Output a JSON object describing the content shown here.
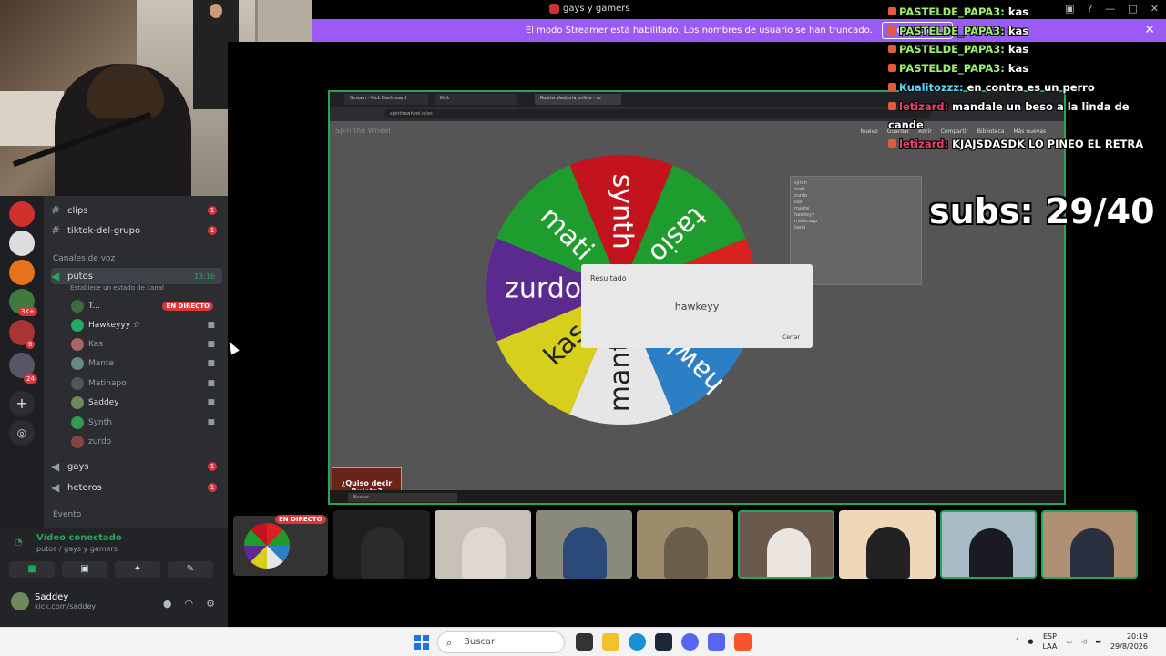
{
  "window": {
    "title": "gays y gamers"
  },
  "banner": {
    "text": "El modo Streamer está habilitado. Los nombres de usuario se han truncado.",
    "button": "Deshabilitar"
  },
  "channels": {
    "text": [
      {
        "name": "clips",
        "badge": "1"
      },
      {
        "name": "tiktok-del-grupo",
        "badge": "1"
      }
    ],
    "voice_category": "Canales de voz",
    "active_voice": {
      "name": "putos",
      "time": "13:16",
      "status": "Establece un estado de canal"
    },
    "members": [
      {
        "name": "T...",
        "live": "EN DIRECTO",
        "dim": false
      },
      {
        "name": "Hawkeyyy ☆",
        "dim": false
      },
      {
        "name": "Kas",
        "dim": true
      },
      {
        "name": "Mante",
        "dim": true
      },
      {
        "name": "Matinapo",
        "dim": true
      },
      {
        "name": "Saddey",
        "dim": false
      },
      {
        "name": "Synth",
        "dim": true
      },
      {
        "name": "zurdo",
        "dim": true
      }
    ],
    "other_voice": [
      {
        "name": "gays",
        "badge": "1"
      },
      {
        "name": "heteros",
        "badge": "1"
      }
    ],
    "events_category": "Evento"
  },
  "servers": {
    "badges": [
      "3K+",
      "6",
      "24"
    ]
  },
  "voice_panel": {
    "status": "Vídeo conectado",
    "location": "putos / gays y gamers",
    "user": "Saddey",
    "user_status": "kick.com/saddey"
  },
  "stream": {
    "url": "spinthewheel.io/es",
    "tabs": [
      "Stream - Kick Dashboard",
      "Kick",
      "Ruleta aleatoria online - ru"
    ],
    "logo": "Spin the Wheel",
    "toolbar": [
      "Nuevo",
      "Guardar",
      "Abrir",
      "Compartir",
      "Biblioteca",
      "Más nuevas"
    ],
    "entries": [
      "synth",
      "mati",
      "zurdo",
      "kas",
      "mante",
      "hawkeyy",
      "matecapp",
      "tasio"
    ],
    "wheel_segments": [
      {
        "label": "tasio",
        "color": "#1e9c2e"
      },
      {
        "label": "matecapp",
        "color": "#d9221f"
      },
      {
        "label": "hawkeyy",
        "color": "#2d7fc5"
      },
      {
        "label": "mante",
        "color": "#e6e6e6"
      },
      {
        "label": "kas",
        "color": "#d6cf1c"
      },
      {
        "label": "zurdo",
        "color": "#5b2a8e"
      },
      {
        "label": "mati",
        "color": "#1e9c2e"
      },
      {
        "label": "synth",
        "color": "#c3141d"
      }
    ],
    "result": {
      "label": "Resultado",
      "value": "hawkeyy",
      "close": "Cerrar"
    },
    "badge": "¿Quiso decir Ruleta?",
    "taskbar_search": "Buscar"
  },
  "chat": [
    {
      "name": "PASTELDE_PAPA3",
      "text": "kas",
      "color": "n1"
    },
    {
      "name": "PASTELDE_PAPA3",
      "text": "kas",
      "color": "n1"
    },
    {
      "name": "PASTELDE_PAPA3",
      "text": "kas",
      "color": "n1"
    },
    {
      "name": "PASTELDE_PAPA3",
      "text": "kas",
      "color": "n1"
    },
    {
      "name": "Kualitozzz",
      "text": "en contra es un perro",
      "color": "n2"
    },
    {
      "name": "letizard",
      "text": "mandale un beso a la linda de cande",
      "color": "n3"
    },
    {
      "name": "letizard",
      "text": "KJAJSDASDK LO PINEO EL RETRA",
      "color": "n3"
    }
  ],
  "subs": "subs: 29/40",
  "live_tag": "EN DIRECTO",
  "taskbar": {
    "search": "Buscar",
    "lang": "ESP",
    "lang2": "LAA",
    "time": "20:19",
    "date": "29/8/2026"
  }
}
